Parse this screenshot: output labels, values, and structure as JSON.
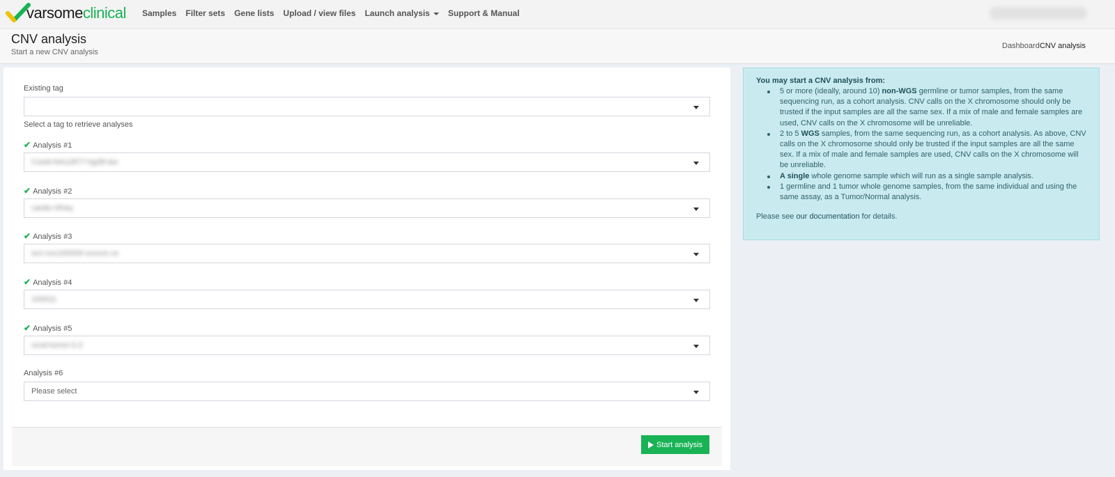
{
  "nav": {
    "logo_part1": "varsome",
    "logo_part2": "clinical",
    "links": [
      "Samples",
      "Filter sets",
      "Gene lists",
      "Upload / view files",
      "Launch analysis",
      "Support & Manual"
    ]
  },
  "header": {
    "title": "CNV analysis",
    "subtitle": "Start a new CNV analysis",
    "breadcrumb_home": "Dashboard",
    "breadcrumb_current": "CNV analysis"
  },
  "form": {
    "tag_label": "Existing tag",
    "tag_value": "",
    "tag_help": "Select a tag to retrieve analyses",
    "analyses": [
      {
        "label": "Analysis #1",
        "value": "Covid-NA12877-hg38-tso",
        "selected": true
      },
      {
        "label": "Analysis #2",
        "value": "cardio trfreq",
        "selected": true
      },
      {
        "label": "Analysis #3",
        "value": "scn-xxx100000-xxxxxx-xx",
        "selected": true
      },
      {
        "label": "Analysis #4",
        "value": "100011",
        "selected": true
      },
      {
        "label": "Analysis #5",
        "value": "xxxd-tumor-0.3",
        "selected": true
      },
      {
        "label": "Analysis #6",
        "value": "Please select",
        "selected": false
      }
    ],
    "start_button": "Start analysis"
  },
  "info": {
    "title": "You may start a CNV analysis from:",
    "items": [
      {
        "pre": "5 or more (ideally, around 10) ",
        "bold": "non-WGS",
        "post": " germline or tumor samples, from the same sequencing run, as a cohort analysis. CNV calls on the X chromosome should only be trusted if the input samples are all the same sex. If a mix of male and female samples are used, CNV calls on the X chromosome will be unreliable."
      },
      {
        "pre": "2 to 5 ",
        "bold": "WGS",
        "post": " samples, from the same sequencing run, as a cohort analysis. As above, CNV calls on the X chromosome should only be trusted if the input samples are all the same sex. If a mix of male and female samples are used, CNV calls on the X chromosome will be unreliable."
      },
      {
        "pre": "",
        "bold": "A single",
        "post": " whole genome sample which will run as a single sample analysis."
      },
      {
        "pre": "1 germline and 1 tumor whole genome samples, from the same individual and using the same assay, as a Tumor/Normal analysis.",
        "bold": "",
        "post": ""
      }
    ],
    "foot_pre": "Please see ",
    "foot_link": "our documentation",
    "foot_post": " for details."
  },
  "colors": {
    "accent": "#19b356",
    "info_bg": "#c9ebef",
    "info_text": "#31606a"
  }
}
